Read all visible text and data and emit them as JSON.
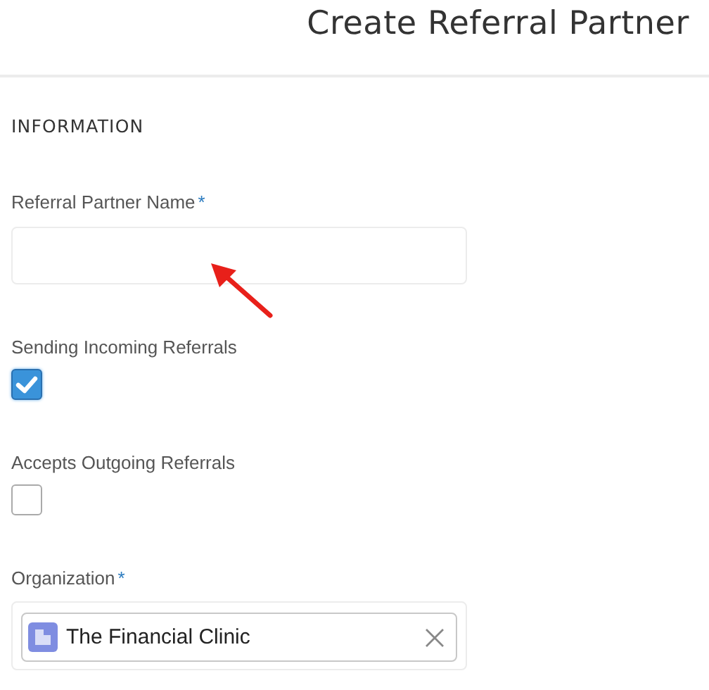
{
  "page": {
    "title": "Create Referral Partner"
  },
  "section": {
    "heading": "INFORMATION"
  },
  "fields": [
    {
      "kind": "text",
      "label": "Referral Partner Name",
      "required": true
    },
    {
      "kind": "checkbox",
      "label": "Sending Incoming Referrals",
      "required": false,
      "checked": true
    },
    {
      "kind": "checkbox",
      "label": "Accepts Outgoing Referrals",
      "required": false,
      "checked": false
    },
    {
      "kind": "lookup",
      "label": "Organization",
      "required": true,
      "value": "The Financial Clinic"
    }
  ],
  "required_mark": "*"
}
